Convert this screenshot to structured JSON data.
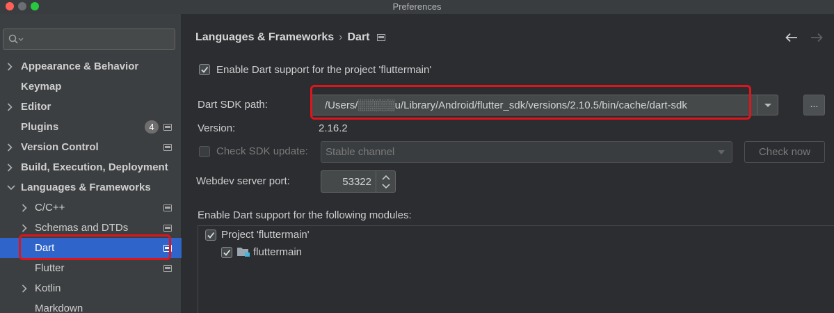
{
  "window": {
    "title": "Preferences"
  },
  "sidebar": {
    "search": {
      "placeholder": "",
      "value": ""
    },
    "items": [
      {
        "label": "Appearance & Behavior",
        "expandable": true,
        "bold": true
      },
      {
        "label": "Keymap",
        "expandable": false,
        "bold": true
      },
      {
        "label": "Editor",
        "expandable": true,
        "bold": true
      },
      {
        "label": "Plugins",
        "expandable": false,
        "bold": true,
        "badge": "4"
      },
      {
        "label": "Version Control",
        "expandable": true,
        "bold": true
      },
      {
        "label": "Build, Execution, Deployment",
        "expandable": true,
        "bold": true
      },
      {
        "label": "Languages & Frameworks",
        "expandable": true,
        "expanded": true,
        "bold": true
      },
      {
        "label": "C/C++",
        "expandable": true
      },
      {
        "label": "Schemas and DTDs",
        "expandable": true
      },
      {
        "label": "Dart",
        "selected": true
      },
      {
        "label": "Flutter"
      },
      {
        "label": "Kotlin",
        "expandable": true
      },
      {
        "label": "Markdown"
      }
    ]
  },
  "header": {
    "breadcrumb_parent": "Languages & Frameworks",
    "breadcrumb_separator": "›",
    "breadcrumb_current": "Dart"
  },
  "dart": {
    "enable_label": "Enable Dart support for the project 'fluttermain'",
    "enable_checked": true,
    "sdk_path_label": "Dart SDK path:",
    "sdk_path_value": "/Users/░░░░░u/Library/Android/flutter_sdk/versions/2.10.5/bin/cache/dart-sdk",
    "browse_label": "...",
    "version_label": "Version:",
    "version_value": "2.16.2",
    "check_sdk_label": "Check SDK update:",
    "check_sdk_checked": false,
    "channel_value": "Stable channel",
    "check_now_label": "Check now",
    "webdev_label": "Webdev server port:",
    "webdev_port": "53322",
    "modules_label": "Enable Dart support for the following modules:",
    "modules": [
      {
        "label": "Project 'fluttermain'",
        "checked": true
      },
      {
        "label": "fluttermain",
        "checked": true
      }
    ]
  },
  "colors": {
    "selection": "#2f65ca",
    "highlight": "#e0141b",
    "sidebar_bg": "#3c3f41",
    "content_bg": "#2b2d30"
  }
}
